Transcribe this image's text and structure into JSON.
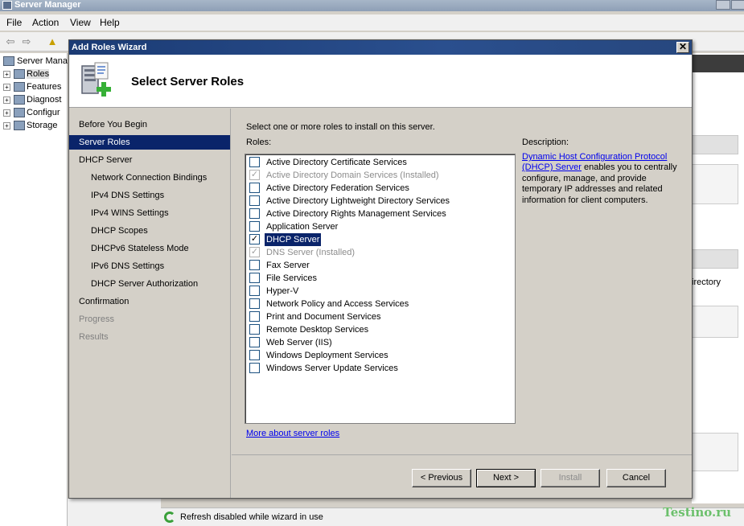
{
  "server_manager": {
    "title": "Server Manager",
    "menu": [
      "File",
      "Action",
      "View",
      "Help"
    ],
    "tree_root": "Server Mana",
    "tree_items": [
      "Roles",
      "Features",
      "Diagnost",
      "Configur",
      "Storage"
    ],
    "right_fragment": "irectory",
    "status": "Refresh disabled while wizard in use"
  },
  "watermark": "Testino.ru",
  "wizard": {
    "title": "Add Roles Wizard",
    "close_glyph": "✕",
    "heading": "Select Server Roles",
    "nav": [
      {
        "label": "Before You Begin",
        "level": 0,
        "state": "normal"
      },
      {
        "label": "Server Roles",
        "level": 0,
        "state": "active"
      },
      {
        "label": "DHCP Server",
        "level": 0,
        "state": "normal"
      },
      {
        "label": "Network Connection Bindings",
        "level": 1,
        "state": "normal"
      },
      {
        "label": "IPv4 DNS Settings",
        "level": 1,
        "state": "normal"
      },
      {
        "label": "IPv4 WINS Settings",
        "level": 1,
        "state": "normal"
      },
      {
        "label": "DHCP Scopes",
        "level": 1,
        "state": "normal"
      },
      {
        "label": "DHCPv6 Stateless Mode",
        "level": 1,
        "state": "normal"
      },
      {
        "label": "IPv6 DNS Settings",
        "level": 1,
        "state": "normal"
      },
      {
        "label": "DHCP Server Authorization",
        "level": 1,
        "state": "normal"
      },
      {
        "label": "Confirmation",
        "level": 0,
        "state": "normal"
      },
      {
        "label": "Progress",
        "level": 0,
        "state": "disabled"
      },
      {
        "label": "Results",
        "level": 0,
        "state": "disabled"
      }
    ],
    "instruction": "Select one or more roles to install on this server.",
    "roles_label": "Roles:",
    "roles": [
      {
        "label": "Active Directory Certificate Services",
        "checked": false,
        "disabled": false,
        "selected": false
      },
      {
        "label": "Active Directory Domain Services  (Installed)",
        "checked": true,
        "disabled": true,
        "selected": false
      },
      {
        "label": "Active Directory Federation Services",
        "checked": false,
        "disabled": false,
        "selected": false
      },
      {
        "label": "Active Directory Lightweight Directory Services",
        "checked": false,
        "disabled": false,
        "selected": false
      },
      {
        "label": "Active Directory Rights Management Services",
        "checked": false,
        "disabled": false,
        "selected": false
      },
      {
        "label": "Application Server",
        "checked": false,
        "disabled": false,
        "selected": false
      },
      {
        "label": "DHCP Server",
        "checked": true,
        "disabled": false,
        "selected": true
      },
      {
        "label": "DNS Server  (Installed)",
        "checked": true,
        "disabled": true,
        "selected": false
      },
      {
        "label": "Fax Server",
        "checked": false,
        "disabled": false,
        "selected": false
      },
      {
        "label": "File Services",
        "checked": false,
        "disabled": false,
        "selected": false
      },
      {
        "label": "Hyper-V",
        "checked": false,
        "disabled": false,
        "selected": false
      },
      {
        "label": "Network Policy and Access Services",
        "checked": false,
        "disabled": false,
        "selected": false
      },
      {
        "label": "Print and Document Services",
        "checked": false,
        "disabled": false,
        "selected": false
      },
      {
        "label": "Remote Desktop Services",
        "checked": false,
        "disabled": false,
        "selected": false
      },
      {
        "label": "Web Server (IIS)",
        "checked": false,
        "disabled": false,
        "selected": false
      },
      {
        "label": "Windows Deployment Services",
        "checked": false,
        "disabled": false,
        "selected": false
      },
      {
        "label": "Windows Server Update Services",
        "checked": false,
        "disabled": false,
        "selected": false
      }
    ],
    "more_link": "More about server roles",
    "description_title": "Description:",
    "description_link": "Dynamic Host Configuration Protocol (DHCP) Server",
    "description_text": " enables you to centrally configure, manage, and provide temporary IP addresses and related information for client computers.",
    "buttons": {
      "previous": "< Previous",
      "next": "Next >",
      "install": "Install",
      "cancel": "Cancel"
    }
  },
  "colors": {
    "selection": "#0a246a",
    "link": "#0000ee",
    "titlebar": "#1b3b74"
  }
}
